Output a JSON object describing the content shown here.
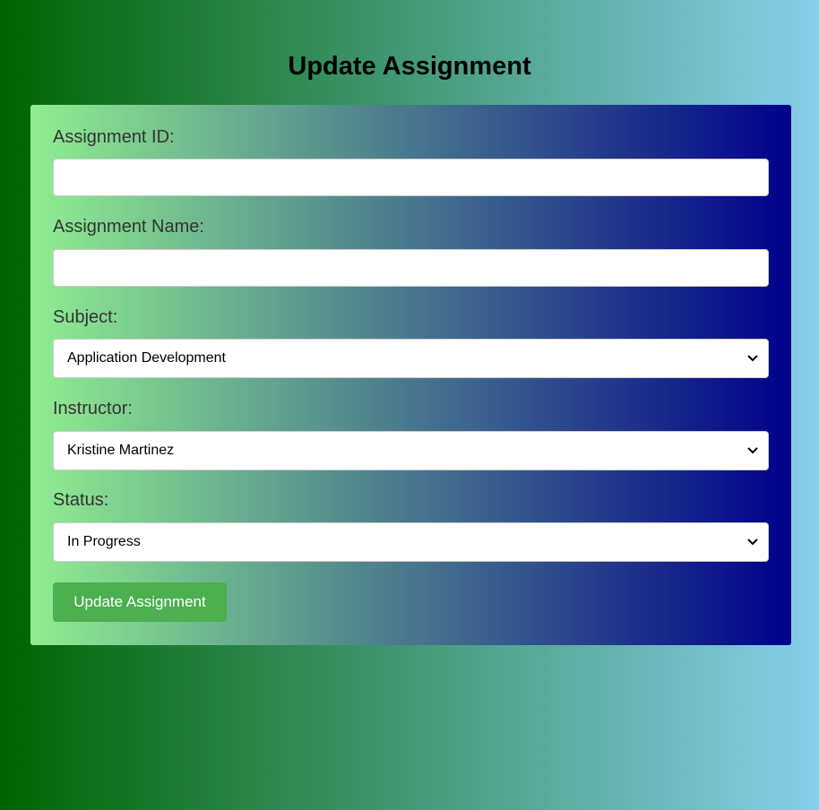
{
  "page": {
    "title": "Update Assignment"
  },
  "form": {
    "assignment_id": {
      "label": "Assignment ID:",
      "value": ""
    },
    "assignment_name": {
      "label": "Assignment Name:",
      "value": ""
    },
    "subject": {
      "label": "Subject:",
      "selected": "Application Development"
    },
    "instructor": {
      "label": "Instructor:",
      "selected": "Kristine Martinez"
    },
    "status": {
      "label": "Status:",
      "selected": "In Progress"
    },
    "submit_label": "Update Assignment"
  },
  "colors": {
    "body_gradient_start": "#006400",
    "body_gradient_end": "#87ceeb",
    "panel_gradient_start": "#90ee90",
    "panel_gradient_end": "#00008b",
    "button": "#4caf50"
  },
  "icons": {
    "select_arrow": "chevron-down-icon"
  }
}
